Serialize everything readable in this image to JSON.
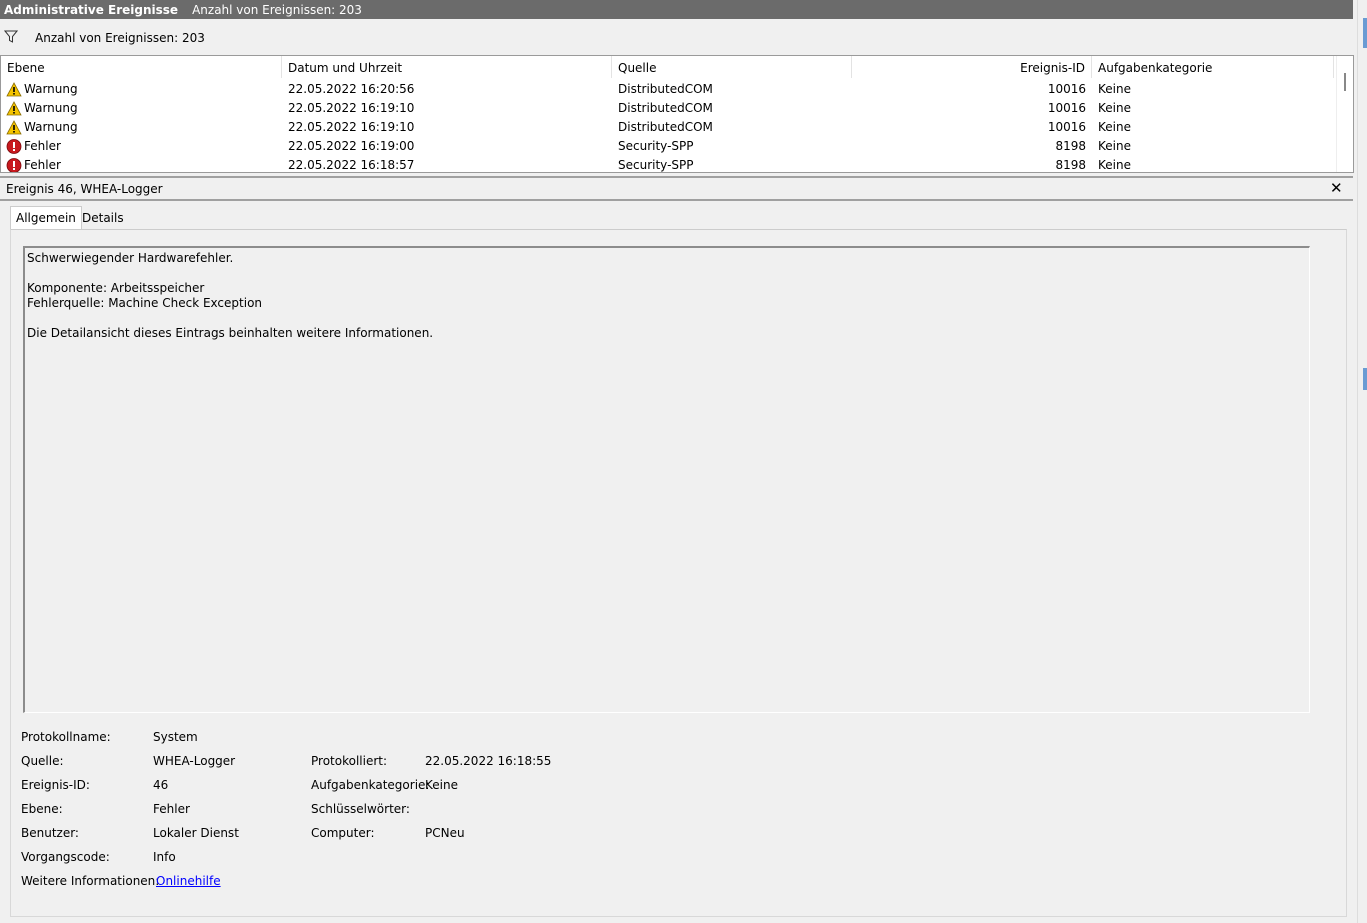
{
  "titlebar": {
    "title": "Administrative Ereignisse",
    "count": "Anzahl von Ereignissen: 203"
  },
  "filterbar": {
    "text": "Anzahl von Ereignissen: 203"
  },
  "grid": {
    "columns": [
      "Ebene",
      "Datum und Uhrzeit",
      "Quelle",
      "Ereignis-ID",
      "Aufgabenkategorie"
    ],
    "rows": [
      {
        "level": "Warnung",
        "icon": "warning-icon",
        "datetime": "22.05.2022 16:20:56",
        "source": "DistributedCOM",
        "id": "10016",
        "category": "Keine"
      },
      {
        "level": "Warnung",
        "icon": "warning-icon",
        "datetime": "22.05.2022 16:19:10",
        "source": "DistributedCOM",
        "id": "10016",
        "category": "Keine"
      },
      {
        "level": "Warnung",
        "icon": "warning-icon",
        "datetime": "22.05.2022 16:19:10",
        "source": "DistributedCOM",
        "id": "10016",
        "category": "Keine"
      },
      {
        "level": "Fehler",
        "icon": "error-icon",
        "datetime": "22.05.2022 16:19:00",
        "source": "Security-SPP",
        "id": "8198",
        "category": "Keine"
      },
      {
        "level": "Fehler",
        "icon": "error-icon",
        "datetime": "22.05.2022 16:18:57",
        "source": "Security-SPP",
        "id": "8198",
        "category": "Keine"
      }
    ]
  },
  "detail": {
    "title": "Ereignis 46, WHEA-Logger",
    "close": "✕",
    "tabs": [
      "Allgemein",
      "Details"
    ],
    "message": [
      "Schwerwiegender Hardwarefehler.",
      "",
      "Komponente: Arbeitsspeicher",
      "Fehlerquelle: Machine Check Exception",
      "",
      "Die Detailansicht dieses Eintrags beinhalten weitere Informationen."
    ],
    "props": {
      "protokollname_label": "Protokollname:",
      "protokollname": "System",
      "quelle_label": "Quelle:",
      "quelle": "WHEA-Logger",
      "protokolliert_label": "Protokolliert:",
      "protokolliert": "22.05.2022 16:18:55",
      "ereignisid_label": "Ereignis-ID:",
      "ereignisid": "46",
      "aufgabe_label": "Aufgabenkategorie:",
      "aufgabe": "Keine",
      "ebene_label": "Ebene:",
      "ebene": "Fehler",
      "schluessel_label": "Schlüsselwörter:",
      "schluessel": "",
      "benutzer_label": "Benutzer:",
      "benutzer": "Lokaler Dienst",
      "computer_label": "Computer:",
      "computer": "PCNeu",
      "vorgang_label": "Vorgangscode:",
      "vorgang": "Info",
      "weitere_label": "Weitere Informationen:",
      "weitere_link": "Onlinehilfe"
    }
  },
  "colors": {
    "titlebar": "#6b6b6b",
    "link": "#0000ff",
    "warning": "#f5c400",
    "error": "#c8191e"
  }
}
